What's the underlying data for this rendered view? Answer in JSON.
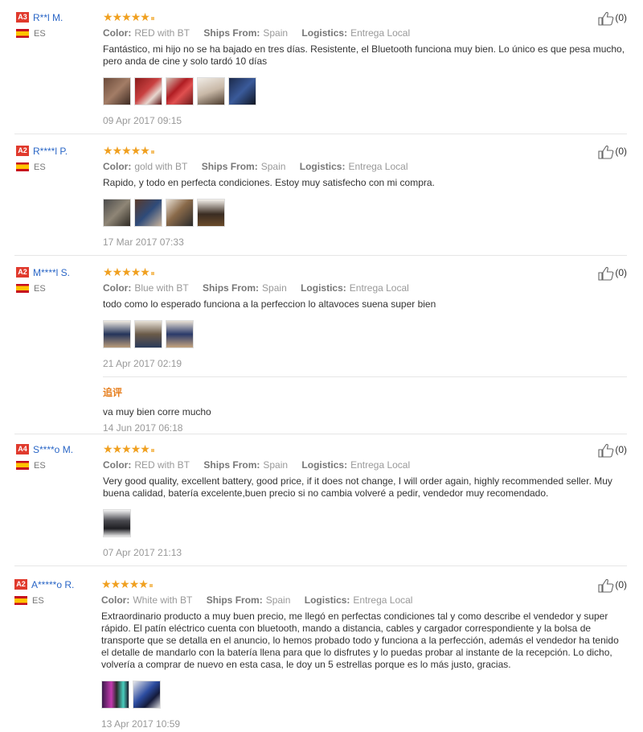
{
  "colors": {
    "level_badge": "#e03a2d",
    "username": "#2a66c6",
    "star": "#f0a020",
    "followup_title": "#e67e1c"
  },
  "labels": {
    "color": "Color:",
    "ships_from": "Ships From:",
    "logistics": "Logistics:"
  },
  "reviews": [
    {
      "level": "A3",
      "user": "R**l M.",
      "country": "ES",
      "rating": 5,
      "color": "RED with BT",
      "ships_from": "Spain",
      "logistics": "Entrega Local",
      "text": "Fantástico, mi hijo no se ha bajado en tres días. Resistente, el Bluetooth funciona muy bien. Lo único es que pesa mucho, pero anda de cine y solo tardó 10 días",
      "photos": [
        "photo",
        "photo",
        "photo",
        "photo",
        "photo"
      ],
      "date": "09 Apr 2017 09:15",
      "helpful": "(0)"
    },
    {
      "level": "A2",
      "user": "R****l P.",
      "country": "ES",
      "rating": 5,
      "color": "gold with BT",
      "ships_from": "Spain",
      "logistics": "Entrega Local",
      "text": "Rapido, y todo en perfecta condiciones. Estoy muy satisfecho con mi compra.",
      "photos": [
        "photo",
        "photo",
        "photo",
        "photo"
      ],
      "date": "17 Mar 2017 07:33",
      "helpful": "(0)"
    },
    {
      "level": "A2",
      "user": "M****l S.",
      "country": "ES",
      "rating": 5,
      "color": "Blue with BT",
      "ships_from": "Spain",
      "logistics": "Entrega Local",
      "text": "todo como lo esperado funciona a la perfeccion lo altavoces suena super bien",
      "photos": [
        "photo",
        "photo",
        "photo"
      ],
      "date": "21 Apr 2017 02:19",
      "helpful": "(0)",
      "followup": {
        "title": "追评",
        "text": "va muy bien corre mucho",
        "date": "14 Jun 2017 06:18"
      }
    },
    {
      "level": "A4",
      "user": "S****o M.",
      "country": "ES",
      "rating": 5,
      "color": "RED with BT",
      "ships_from": "Spain",
      "logistics": "Entrega Local",
      "text": "Very good quality, excellent battery, good price, if it does not change, I will order again, highly recommended seller. Muy buena calidad, batería excelente,buen precio si no cambia volveré a pedir, vendedor muy recomendado.",
      "photos": [
        "photo"
      ],
      "date": "07 Apr 2017 21:13",
      "helpful": "(0)"
    },
    {
      "level": "A2",
      "user": "A*****o R.",
      "country": "ES",
      "rating": 5,
      "color": "White with BT",
      "ships_from": "Spain",
      "logistics": "Entrega Local",
      "text": "Extraordinario producto a muy buen precio, me llegó en perfectas condiciones tal y como describe el vendedor y super rápido. El patín eléctrico cuenta con bluetooth, mando a distancia, cables y cargador correspondiente y la bolsa de transporte que se detalla en el anuncio, lo hemos probado todo y funciona a la perfección, además el vendedor ha tenido el detalle de mandarlo con la batería llena para que lo disfrutes y lo puedas probar al instante de la recepción. Lo dicho, volvería a comprar de nuevo en esta casa, le doy un 5 estrellas porque es lo más justo, gracias.",
      "photos": [
        "photo",
        "photo"
      ],
      "date": "13 Apr 2017 10:59",
      "helpful": "(0)"
    }
  ]
}
